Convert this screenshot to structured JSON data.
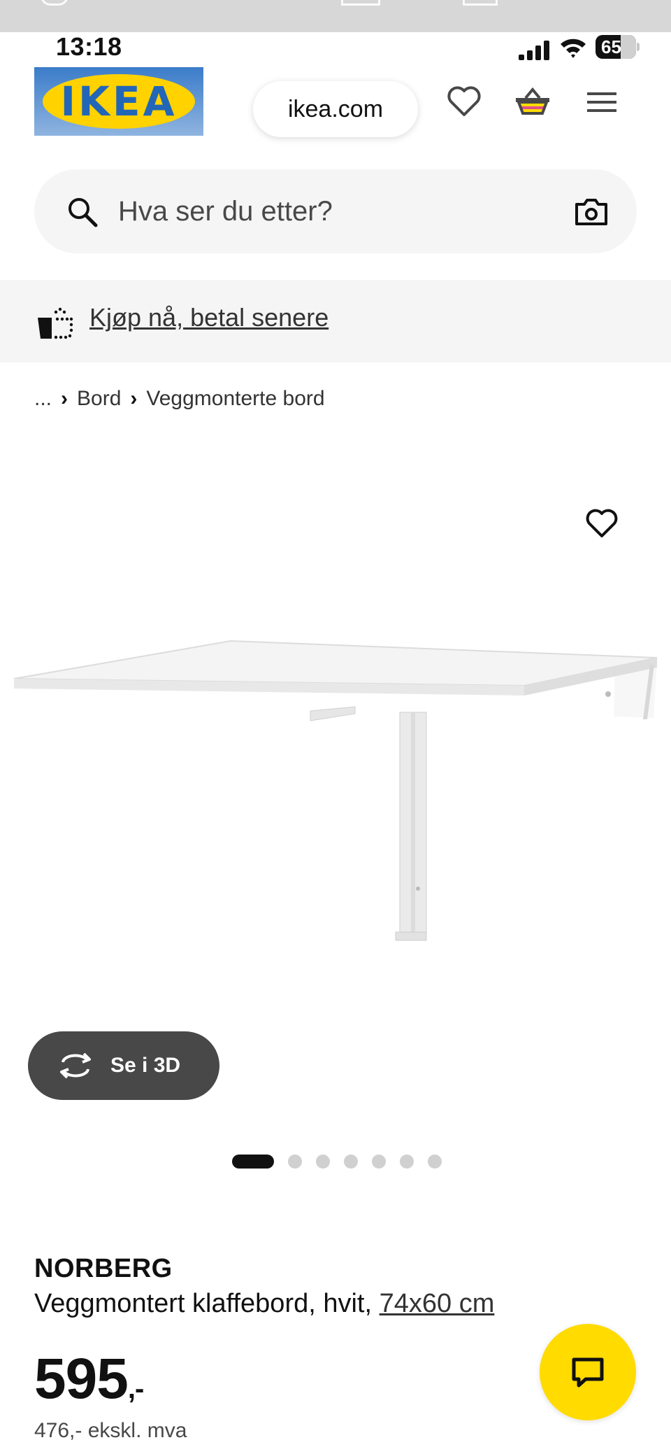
{
  "status_bar": {
    "time": "13:18",
    "battery": "65"
  },
  "header": {
    "logo_text": "IKEA",
    "url": "ikea.com",
    "icons": [
      "heart-icon",
      "basket-icon",
      "menu-icon"
    ]
  },
  "search": {
    "placeholder": "Hva ser du etter?",
    "icons": [
      "search-icon",
      "camera-icon"
    ]
  },
  "promo": {
    "text": "Kjøp nå, betal senere"
  },
  "breadcrumb": {
    "items": [
      "...",
      "Bord",
      "Veggmonterte bord"
    ]
  },
  "gallery": {
    "view_3d_label": "Se i 3D",
    "image_count": 7,
    "active_index": 0
  },
  "product": {
    "name": "NORBERG",
    "description": "Veggmontert klaffebord, hvit,",
    "size": "74x60 cm",
    "price": "595",
    "price_suffix": ",-",
    "price_ex_vat": "476,- ekskl. mva"
  },
  "colors": {
    "brand_blue": "#0058A3",
    "brand_yellow": "#FFDB00",
    "text": "#111111",
    "muted": "#484848"
  }
}
